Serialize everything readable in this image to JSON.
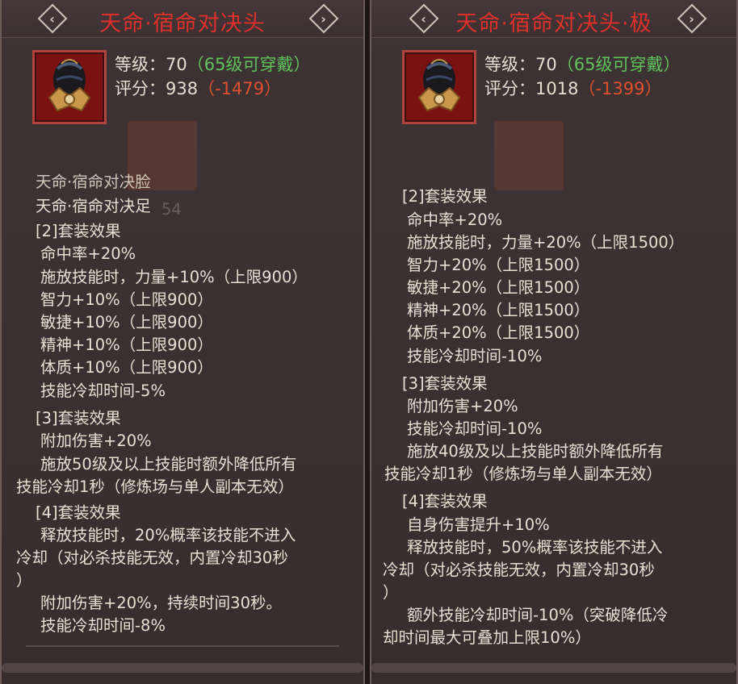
{
  "left": {
    "title": "天命·宿命对决头",
    "level_label": "等级：70",
    "level_req": "（65级可穿戴）",
    "score_label": "评分：938",
    "score_diff": "（-1479）",
    "faded_text": "54",
    "lines": [
      "天命·宿命对决脸",
      "天命·宿命对决足",
      "[2]套装效果",
      "命中率+20%",
      "施放技能时，力量+10%（上限900）",
      "智力+10%（上限900）",
      "敏捷+10%（上限900）",
      "精神+10%（上限900）",
      "体质+10%（上限900）",
      "技能冷却时间-5%",
      "[3]套装效果",
      "附加伤害+20%",
      "施放50级及以上技能时额外降低所有",
      "技能冷却1秒（修炼场与单人副本无效）",
      "[4]套装效果",
      "释放技能时，20%概率该技能不进入",
      "冷却（对必杀技能无效，内置冷却30秒",
      "）",
      "附加伤害+20%，持续时间30秒。",
      "技能冷却时间-8%"
    ]
  },
  "right": {
    "title": "天命·宿命对决头·极",
    "level_label": "等级：70",
    "level_req": "（65级可穿戴）",
    "score_label": "评分：1018",
    "score_diff": "（-1399）",
    "lines": [
      "[2]套装效果",
      "命中率+20%",
      "施放技能时，力量+20%（上限1500）",
      "智力+20%（上限1500）",
      "敏捷+20%（上限1500）",
      "精神+20%（上限1500）",
      "体质+20%（上限1500）",
      "技能冷却时间-10%",
      "[3]套装效果",
      "附加伤害+20%",
      "技能冷却时间-10%",
      "施放40级及以上技能时额外降低所有",
      "技能冷却1秒（修炼场与单人副本无效）",
      "[4]套装效果",
      "自身伤害提升+10%",
      "释放技能时，50%概率该技能不进入",
      "冷却（对必杀技能无效，内置冷却30秒",
      "）",
      "额外技能冷却时间-10%（突破降低冷",
      "却时间最大可叠加上限10%）"
    ]
  },
  "colors": {
    "title_red": "#e0302a",
    "green": "#5fc25a",
    "diff": "#e0502c",
    "text": "#e8e0d2"
  },
  "icons": {
    "nav_prev": "chevron-left-diamond",
    "nav_next": "chevron-right-diamond",
    "item": "helmet"
  }
}
